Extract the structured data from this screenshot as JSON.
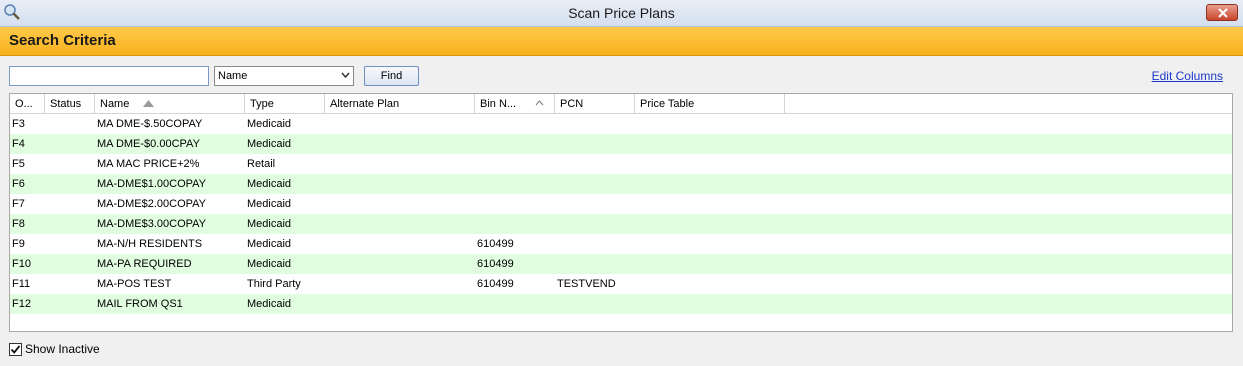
{
  "window": {
    "title": "Scan Price Plans",
    "icon": "magnifier-icon"
  },
  "section": {
    "title": "Search Criteria"
  },
  "search": {
    "value": "",
    "placeholder": "",
    "field": "Name",
    "find_label": "Find"
  },
  "edit_columns_label": "Edit Columns",
  "columns": [
    "O...",
    "Status",
    "Name",
    "Type",
    "Alternate Plan",
    "Bin N...",
    "PCN",
    "Price Table"
  ],
  "rows": [
    [
      "F3",
      "",
      "MA DME-$.50COPAY",
      "Medicaid",
      "",
      "",
      "",
      ""
    ],
    [
      "F4",
      "",
      "MA DME-$0.00CPAY",
      "Medicaid",
      "",
      "",
      "",
      ""
    ],
    [
      "F5",
      "",
      "MA MAC PRICE+2%",
      "Retail",
      "",
      "",
      "",
      ""
    ],
    [
      "F6",
      "",
      "MA-DME$1.00COPAY",
      "Medicaid",
      "",
      "",
      "",
      ""
    ],
    [
      "F7",
      "",
      "MA-DME$2.00COPAY",
      "Medicaid",
      "",
      "",
      "",
      ""
    ],
    [
      "F8",
      "",
      "MA-DME$3.00COPAY",
      "Medicaid",
      "",
      "",
      "",
      ""
    ],
    [
      "F9",
      "",
      "MA-N/H RESIDENTS",
      "Medicaid",
      "",
      "610499",
      "",
      ""
    ],
    [
      "F10",
      "",
      "MA-PA REQUIRED",
      "Medicaid",
      "",
      "610499",
      "",
      ""
    ],
    [
      "F11",
      "",
      "MA-POS TEST",
      "Third Party",
      "",
      "610499",
      "TESTVEND",
      ""
    ],
    [
      "F12",
      "",
      "MAIL FROM QS1",
      "Medicaid",
      "",
      "",
      "",
      ""
    ]
  ],
  "show_inactive": {
    "label": "Show Inactive",
    "checked": true
  },
  "colors": {
    "header_band": "#f7b21d",
    "alt_row": "#e0fde0",
    "link": "#1c37c9",
    "close": "#c8442a"
  }
}
